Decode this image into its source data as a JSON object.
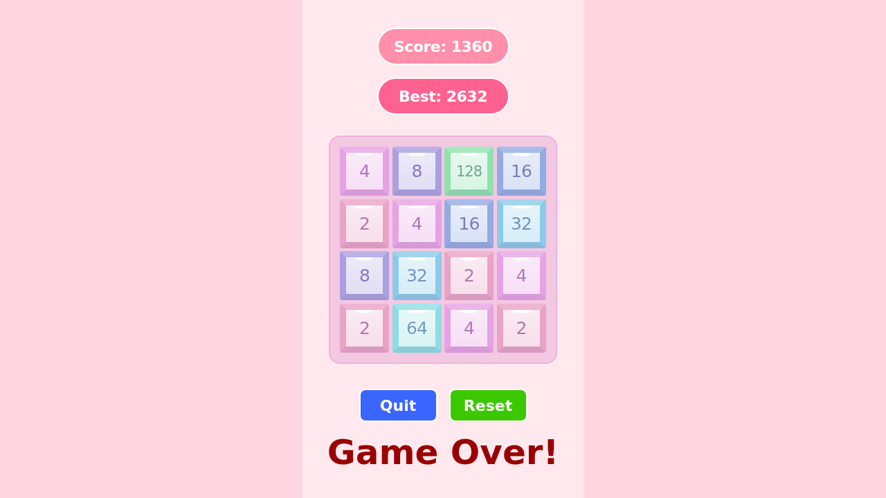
{
  "score": {
    "label": "Score: 1360"
  },
  "best": {
    "label": "Best: 2632"
  },
  "board": {
    "tiles": [
      {
        "value": "4",
        "color": "#e6a3e3"
      },
      {
        "value": "8",
        "color": "#ab9fe0"
      },
      {
        "value": "128",
        "color": "#8fe2ae"
      },
      {
        "value": "16",
        "color": "#93abe2"
      },
      {
        "value": "2",
        "color": "#e9a3c6"
      },
      {
        "value": "4",
        "color": "#e6a3e3"
      },
      {
        "value": "16",
        "color": "#93abe2"
      },
      {
        "value": "32",
        "color": "#8ccbe8"
      },
      {
        "value": "8",
        "color": "#ab9fe0"
      },
      {
        "value": "32",
        "color": "#8ccbe8"
      },
      {
        "value": "2",
        "color": "#e9a3c6"
      },
      {
        "value": "4",
        "color": "#e6a3e3"
      },
      {
        "value": "2",
        "color": "#e9a3c6"
      },
      {
        "value": "64",
        "color": "#8edde2"
      },
      {
        "value": "4",
        "color": "#e6a3e3"
      },
      {
        "value": "2",
        "color": "#e9a3c6"
      }
    ]
  },
  "buttons": [
    {
      "label": "Quit",
      "kind": "quit"
    },
    {
      "label": "Reset",
      "kind": "reset"
    }
  ],
  "message": "Game Over!"
}
